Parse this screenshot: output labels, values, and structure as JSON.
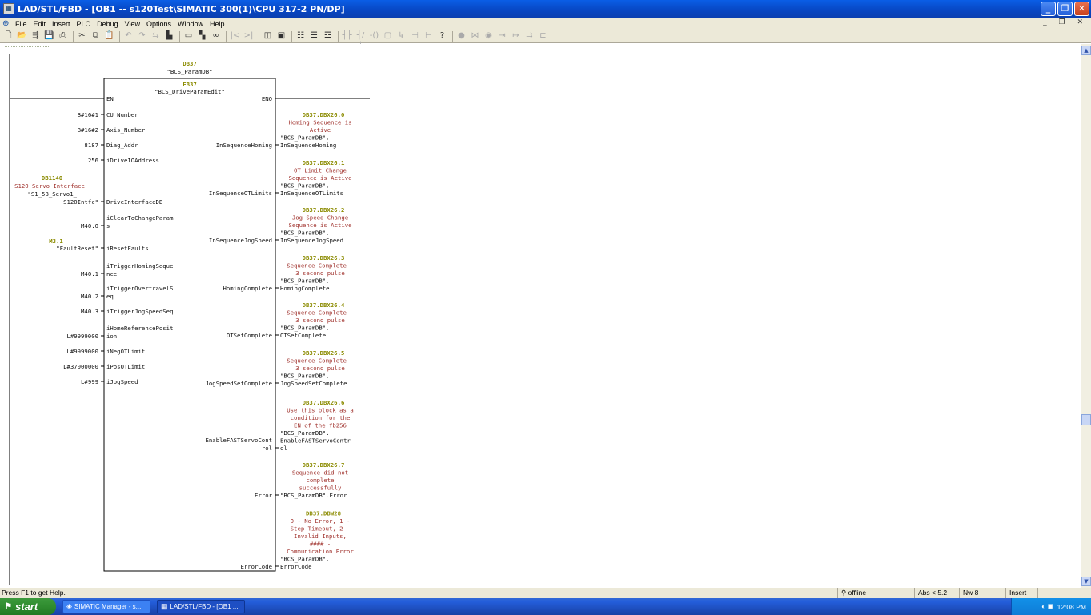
{
  "window": {
    "title": "LAD/STL/FBD - [OB1 -- s120Test\\SIMATIC 300(1)\\CPU 317-2 PN/DP]",
    "app_icon": "ladder-app-icon"
  },
  "menu": {
    "items": [
      "File",
      "Edit",
      "Insert",
      "PLC",
      "Debug",
      "View",
      "Options",
      "Window",
      "Help"
    ]
  },
  "editor": {
    "instance_db": {
      "address": "DB37",
      "symbol": "\"BCS_ParamDB\""
    },
    "block": {
      "address": "FB37",
      "symbol": "\"BCS_DriveParamEdit\"",
      "en": "EN",
      "eno": "ENO"
    },
    "db1140": {
      "address": "DB1140",
      "comment": "S120 Servo Interface",
      "symbol_line1": "\"S1_58_Servo1_",
      "symbol_line2": "S120Intfc\""
    },
    "m31": {
      "address": "M3.1",
      "symbol": "\"FaultReset\""
    },
    "inputs": [
      {
        "operand": "B#16#1",
        "pin": "CU_Number"
      },
      {
        "operand": "B#16#2",
        "pin": "Axis_Number"
      },
      {
        "operand": "8187",
        "pin": "Diag_Addr"
      },
      {
        "operand": "256",
        "pin": "iDriveIOAddress"
      },
      {
        "operand": "",
        "pin": "DriveInterfaceDB"
      },
      {
        "operand": "M40.0",
        "pin": "iClearToChangeParam",
        "pin2": "s"
      },
      {
        "operand": "",
        "pin": "iResetFaults"
      },
      {
        "operand": "M40.1",
        "pin": "iTriggerHomingSeque",
        "pin2": "nce"
      },
      {
        "operand": "M40.2",
        "pin": "iTriggerOvertravelS",
        "pin2": "eq"
      },
      {
        "operand": "M40.3",
        "pin": "iTriggerJogSpeedSeq"
      },
      {
        "operand": "L#9999000",
        "pin": "iHomeReferencePosit",
        "pin2": "ion"
      },
      {
        "operand": "L#9999000",
        "pin": "iNegOTLimit"
      },
      {
        "operand": "L#37000000",
        "pin": "iPosOTLimit"
      },
      {
        "operand": "L#999",
        "pin": "iJogSpeed"
      }
    ],
    "outputs": [
      {
        "pin": "InSequenceHoming",
        "address": "DB37.DBX26.0",
        "comment": [
          "Homing Sequence is",
          "Active"
        ],
        "sym1": "\"BCS_ParamDB\".",
        "sym2": "InSequenceHoming"
      },
      {
        "pin": "InSequenceOTLimits",
        "address": "DB37.DBX26.1",
        "comment": [
          "OT Limit Change",
          "Sequence is Active"
        ],
        "sym1": "\"BCS_ParamDB\".",
        "sym2": "InSequenceOTLimits"
      },
      {
        "pin": "InSequenceJogSpeed",
        "address": "DB37.DBX26.2",
        "comment": [
          "Jog Speed Change",
          "Sequence is Active"
        ],
        "sym1": "\"BCS_ParamDB\".",
        "sym2": "InSequenceJogSpeed"
      },
      {
        "pin": "HomingComplete",
        "address": "DB37.DBX26.3",
        "comment": [
          "Sequence Complete -",
          "3 second pulse"
        ],
        "sym1": "\"BCS_ParamDB\".",
        "sym2": "HomingComplete"
      },
      {
        "pin": "OTSetComplete",
        "address": "DB37.DBX26.4",
        "comment": [
          "Sequence Complete -",
          "3 second pulse"
        ],
        "sym1": "\"BCS_ParamDB\".",
        "sym2": "OTSetComplete"
      },
      {
        "pin": "JogSpeedSetComplete",
        "address": "DB37.DBX26.5",
        "comment": [
          "Sequence Complete -",
          "3 second pulse"
        ],
        "sym1": "\"BCS_ParamDB\".",
        "sym2": "JogSpeedSetComplete"
      },
      {
        "pin": "EnableFASTServoCont",
        "pin2": "rol",
        "address": "DB37.DBX26.6",
        "comment": [
          "Use this block as a",
          "condition for the",
          "EN of the fb256"
        ],
        "sym1": "\"BCS_ParamDB\".",
        "sym2": "EnableFASTServoContr",
        "sym3": "ol"
      },
      {
        "pin": "Error",
        "address": "DB37.DBX26.7",
        "comment": [
          "Sequence did not",
          "complete",
          "successfully"
        ],
        "sym1": "\"BCS_ParamDB\".Error"
      },
      {
        "pin": "ErrorCode",
        "address": "DB37.DBW28",
        "comment": [
          "0 - No Error, 1 -",
          "Step Timeout, 2 -",
          "Invalid Inputs,",
          "####  -",
          "Communication Error"
        ],
        "sym1": "\"BCS_ParamDB\".",
        "sym2": "ErrorCode"
      }
    ]
  },
  "status": {
    "help": "Press F1 to get Help.",
    "online": "offline",
    "abs": "Abs < 5.2",
    "nw": "Nw 8",
    "mode": "Insert"
  },
  "taskbar": {
    "start": "start",
    "tasks": [
      "SIMATIC Manager - s...",
      "LAD/STL/FBD - [OB1 ..."
    ],
    "clock": "12:08 PM"
  },
  "colors": {
    "address": "#8b8b00",
    "comment": "#a0322d",
    "titlebar": "#0a5ee6"
  }
}
